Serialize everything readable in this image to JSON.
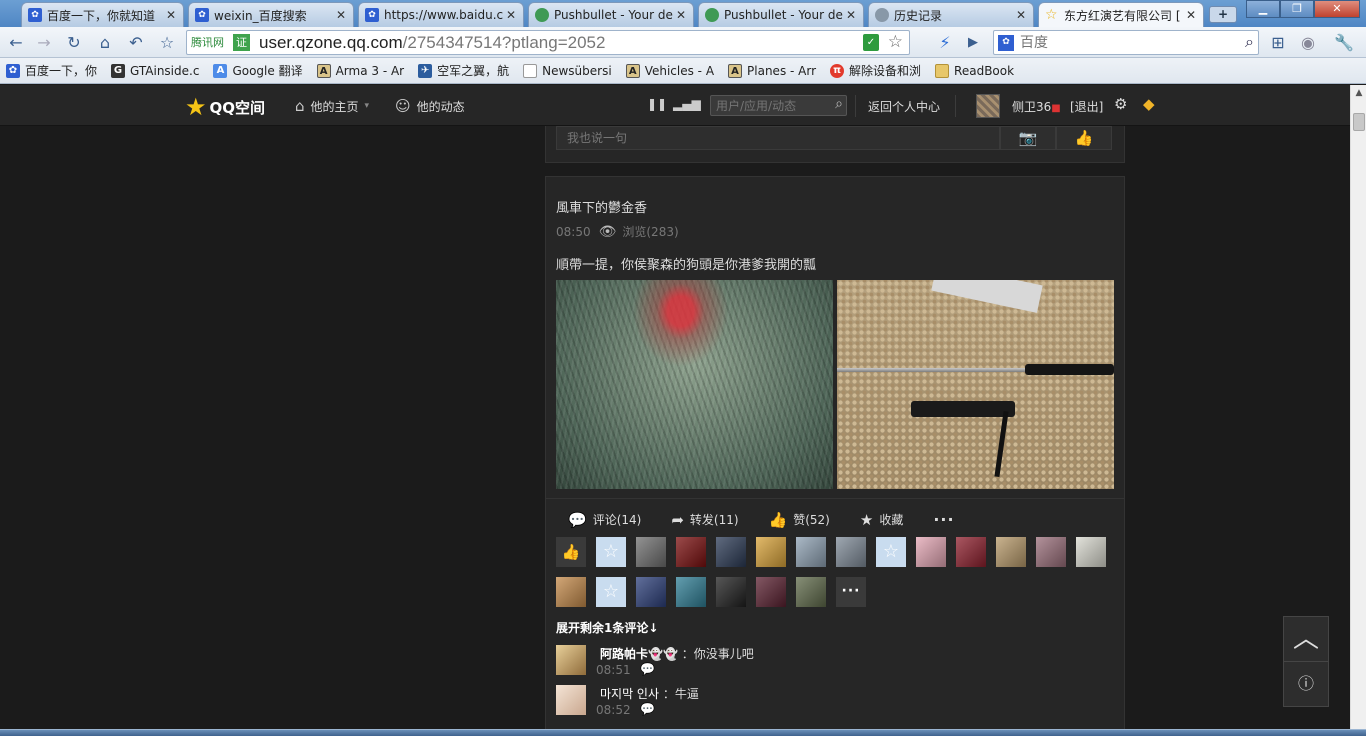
{
  "browser": {
    "tabs": [
      {
        "title": "百度一下，你就知道",
        "icon": "paw-icon",
        "active": false
      },
      {
        "title": "weixin_百度搜索",
        "icon": "paw-icon",
        "active": false
      },
      {
        "title": "https://www.baidu.c",
        "icon": "paw-icon",
        "active": false
      },
      {
        "title": "Pushbullet - Your de",
        "icon": "pushbullet-icon",
        "active": false
      },
      {
        "title": "Pushbullet - Your de",
        "icon": "pushbullet-icon",
        "active": false
      },
      {
        "title": "历史记录",
        "icon": "history-icon",
        "active": false
      },
      {
        "title": "东方红演艺有限公司 [",
        "icon": "star-icon",
        "active": true
      }
    ],
    "new_tab": "+",
    "url_prefix_badge": "腾讯网",
    "url_host": "user.qzone.qq.com",
    "url_path": "/2754347514?ptlang=2052",
    "search_engine_placeholder": "百度",
    "bookmarks": [
      {
        "label": "百度一下，你",
        "icon": "paw-icon"
      },
      {
        "label": "GTAinside.c",
        "icon": "gta-icon"
      },
      {
        "label": "Google 翻译",
        "icon": "translate-icon"
      },
      {
        "label": "Arma 3 - Ar",
        "icon": "armaholic-icon"
      },
      {
        "label": "空军之翼，航",
        "icon": "airforce-icon"
      },
      {
        "label": "Newsübersi",
        "icon": "page-icon"
      },
      {
        "label": "Vehicles - A",
        "icon": "armaholic-icon"
      },
      {
        "label": "Planes - Arr",
        "icon": "armaholic-icon"
      },
      {
        "label": "解除设备和浏",
        "icon": "remove-icon"
      },
      {
        "label": "ReadBook",
        "icon": "folder-icon"
      }
    ]
  },
  "qzone_header": {
    "logo": "QQ空间",
    "nav_home": "他的主页",
    "nav_feed": "他的动态",
    "search_placeholder": "用户/应用/动态",
    "back_link": "返回个人中心",
    "username": "侧卫36",
    "logout": "[退出]"
  },
  "prev_post": {
    "comment_placeholder": "我也说一句"
  },
  "post": {
    "author": "風車下的鬱金香",
    "time": "08:50",
    "views": "浏览(283)",
    "text": "順帶一提，你侯聚森的狗頭是你港爹我開的瓢",
    "actions": {
      "comment": "评论(14)",
      "forward": "转发(11)",
      "like": "赞(52)",
      "favorite": "收藏",
      "more": "···"
    },
    "like_avatars_row1": [
      {
        "kind": "like-button",
        "bg": "#3a3a3a"
      },
      {
        "kind": "default",
        "bg": "#c9dcef"
      },
      {
        "kind": "photo",
        "bg": "#6f6f6f"
      },
      {
        "kind": "photo",
        "bg": "#7a0e0e"
      },
      {
        "kind": "photo",
        "bg": "#2b3a55"
      },
      {
        "kind": "photo",
        "bg": "#d9a339"
      },
      {
        "kind": "photo",
        "bg": "#8fa2b4"
      },
      {
        "kind": "photo",
        "bg": "#7f8b98"
      },
      {
        "kind": "default",
        "bg": "#c9dcef"
      },
      {
        "kind": "photo",
        "bg": "#e4a6b4"
      },
      {
        "kind": "photo",
        "bg": "#8e1f2d"
      },
      {
        "kind": "photo",
        "bg": "#b89a6a"
      },
      {
        "kind": "photo",
        "bg": "#9a6e7a"
      },
      {
        "kind": "photo",
        "bg": "#d9d9cf"
      }
    ],
    "like_avatars_row2": [
      {
        "kind": "photo",
        "bg": "#c48a4a"
      },
      {
        "kind": "default",
        "bg": "#c9dcef"
      },
      {
        "kind": "photo",
        "bg": "#2c3f7a"
      },
      {
        "kind": "photo",
        "bg": "#2f7e95"
      },
      {
        "kind": "photo",
        "bg": "#1f1f1f"
      },
      {
        "kind": "photo",
        "bg": "#5a2030"
      },
      {
        "kind": "photo",
        "bg": "#5f6a4a"
      },
      {
        "kind": "more-button",
        "bg": "#3a3a3a"
      }
    ],
    "expand_comments": "展开剩余1条评论↓",
    "comments": [
      {
        "name": "阿路帕卡👻👻",
        "text": "：你没事儿吧",
        "time": "08:51",
        "avatar_bg": "#c8a46a"
      },
      {
        "name": "마지막 인사",
        "text": "：牛逼",
        "time": "08:52",
        "avatar_bg": "#e6cdb8"
      }
    ]
  }
}
